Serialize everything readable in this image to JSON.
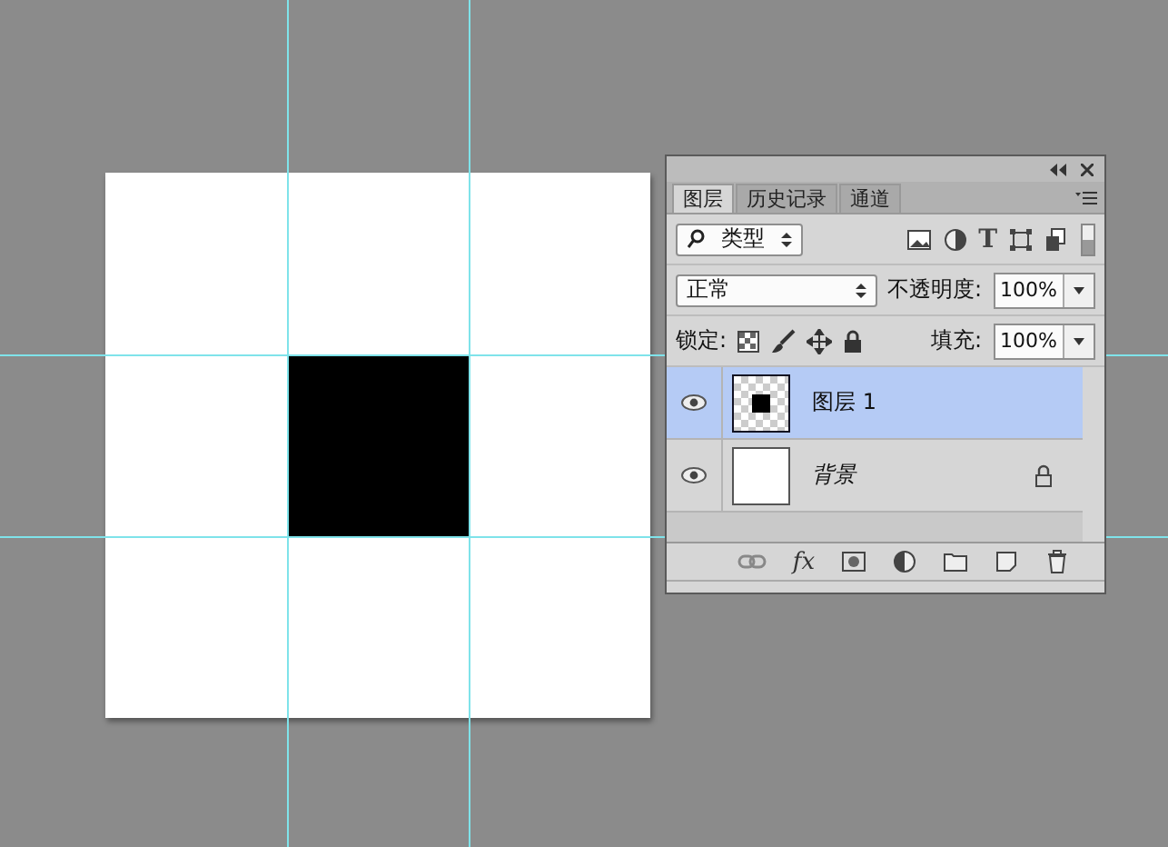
{
  "panel": {
    "tabs": [
      {
        "label": "图层",
        "selected": true
      },
      {
        "label": "历史记录",
        "selected": false
      },
      {
        "label": "通道",
        "selected": false
      }
    ],
    "filter": {
      "value": "类型"
    },
    "type_filter_glyph": "T",
    "blend_mode": {
      "value": "正常"
    },
    "opacity": {
      "label": "不透明度:",
      "value": "100%"
    },
    "lock": {
      "label": "锁定:"
    },
    "fill": {
      "label": "填充:",
      "value": "100%"
    },
    "layers": [
      {
        "name": "图层 1",
        "visible": true,
        "selected": true,
        "locked": false,
        "kind": "pixel"
      },
      {
        "name": "背景",
        "visible": true,
        "selected": false,
        "locked": true,
        "kind": "background"
      }
    ],
    "fx_label": "fx"
  }
}
